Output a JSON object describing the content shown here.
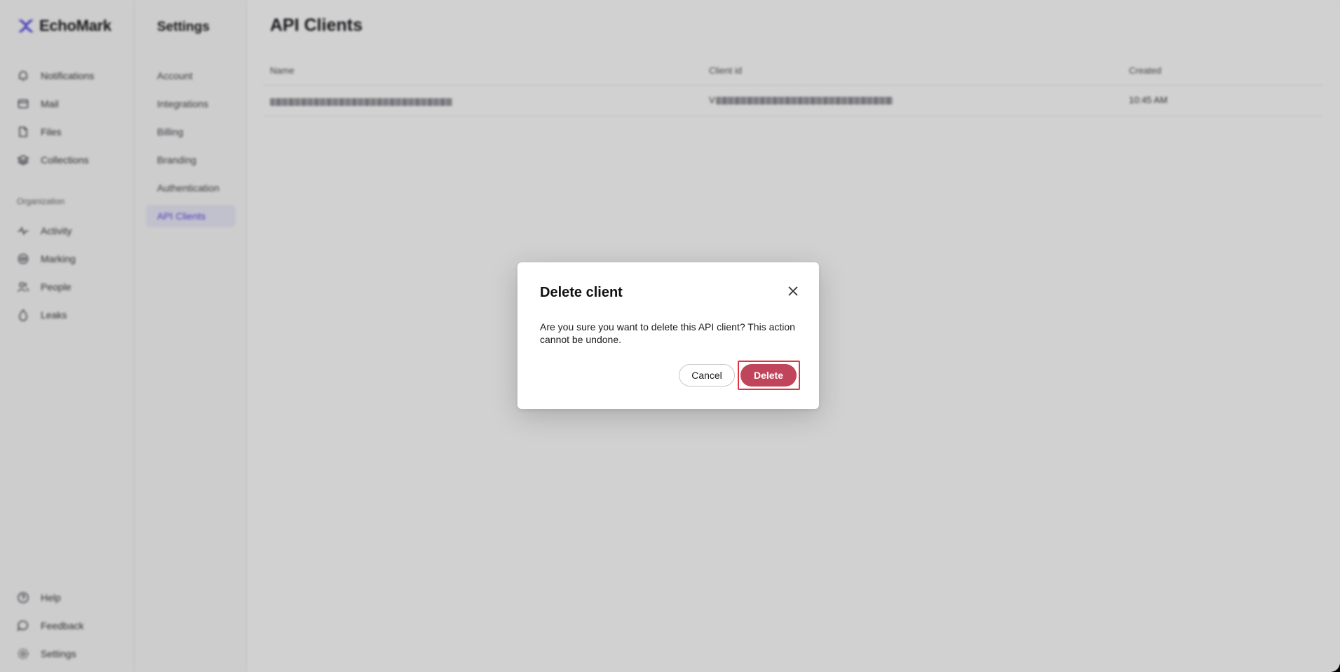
{
  "brand": {
    "name": "EchoMark",
    "accent": "#5b4ee6"
  },
  "sidebar": {
    "items": [
      {
        "label": "Notifications",
        "icon": "bell-icon"
      },
      {
        "label": "Mail",
        "icon": "mail-icon"
      },
      {
        "label": "Files",
        "icon": "file-icon"
      },
      {
        "label": "Collections",
        "icon": "stack-icon"
      }
    ],
    "section_label": "Organization",
    "org_items": [
      {
        "label": "Activity",
        "icon": "activity-icon"
      },
      {
        "label": "Marking",
        "icon": "marking-icon"
      },
      {
        "label": "People",
        "icon": "people-icon"
      },
      {
        "label": "Leaks",
        "icon": "drop-icon"
      }
    ],
    "footer_items": [
      {
        "label": "Help",
        "icon": "help-icon"
      },
      {
        "label": "Feedback",
        "icon": "chat-icon"
      },
      {
        "label": "Settings",
        "icon": "gear-icon"
      }
    ]
  },
  "settings_nav": {
    "title": "Settings",
    "items": [
      "Account",
      "Integrations",
      "Billing",
      "Branding",
      "Authentication",
      "API Clients"
    ],
    "active": "API Clients"
  },
  "main": {
    "title": "API Clients",
    "columns": [
      "Name",
      "Client id",
      "Created"
    ],
    "rows": [
      {
        "client_id_prefix": "V",
        "created": "10:45 AM"
      }
    ]
  },
  "modal": {
    "title": "Delete client",
    "body": "Are you sure you want to delete this API client? This action cannot be undone.",
    "cancel_label": "Cancel",
    "delete_label": "Delete",
    "delete_color": "#c0455a"
  }
}
